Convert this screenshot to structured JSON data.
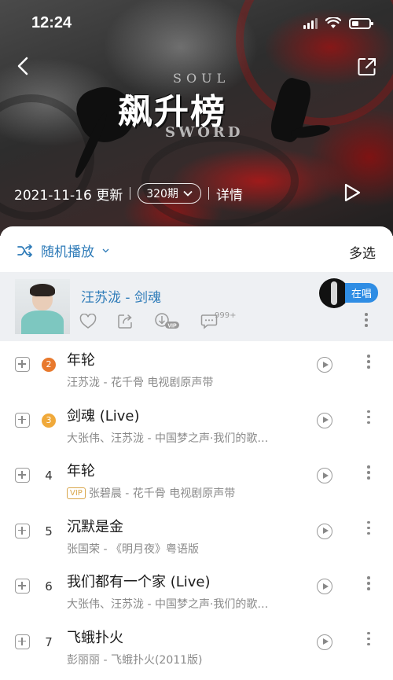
{
  "status_bar": {
    "time": "12:24"
  },
  "header": {
    "title": "飙升榜",
    "logo_soul": "SOUL",
    "logo_sword": "SWORD",
    "update_date": "2021-11-16 更新",
    "issue": "320期",
    "details": "详情"
  },
  "toolbar": {
    "shuffle_label": "随机播放",
    "multi_select": "多选"
  },
  "now_playing": {
    "title": "汪苏泷 - 剑魂",
    "comment_count": "999+",
    "singing_label": "在唱"
  },
  "songs": [
    {
      "rank": "2",
      "rank_color": "#e8792d",
      "title": "年轮",
      "subtitle": "汪苏泷 - 花千骨 电视剧原声带",
      "vip": ""
    },
    {
      "rank": "3",
      "rank_color": "#f0a93a",
      "title": "剑魂 (Live)",
      "subtitle": "大张伟、汪苏泷 - 中国梦之声·我们的歌…",
      "vip": ""
    },
    {
      "rank": "4",
      "rank_color": "",
      "title": "年轮",
      "subtitle": "张碧晨 - 花千骨 电视剧原声带",
      "vip": "VIP"
    },
    {
      "rank": "5",
      "rank_color": "",
      "title": "沉默是金",
      "subtitle": "张国荣 - 《明月夜》粤语版",
      "vip": ""
    },
    {
      "rank": "6",
      "rank_color": "",
      "title": "我们都有一个家 (Live)",
      "subtitle": "大张伟、汪苏泷 - 中国梦之声·我们的歌…",
      "vip": ""
    },
    {
      "rank": "7",
      "rank_color": "",
      "title": "飞蛾扑火",
      "subtitle": "彭丽丽 - 飞蛾扑火(2011版)",
      "vip": ""
    }
  ],
  "colors": {
    "accent": "#2e7bb8",
    "singing_badge": "#2f8de4"
  }
}
